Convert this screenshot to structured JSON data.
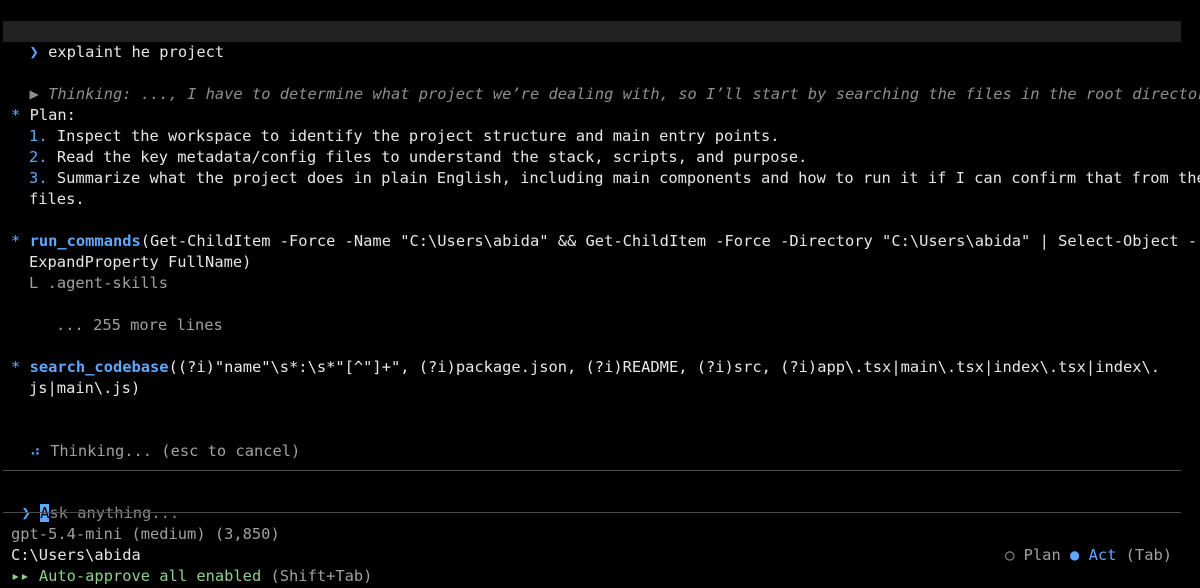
{
  "prompt": {
    "chevron": "❯",
    "text": "explaint he project"
  },
  "thinking": {
    "marker": "▶",
    "text": "Thinking: ..., I have to determine what project we’re dealing with, so I’ll start by searching the files in the root directory."
  },
  "plan": {
    "bullet": "*",
    "title": "Plan:",
    "steps": [
      {
        "num": "1.",
        "text": "Inspect the workspace to identify the project structure and main entry points."
      },
      {
        "num": "2.",
        "text": "Read the key metadata/config files to understand the stack, scripts, and purpose."
      },
      {
        "num": "3.",
        "text": "Summarize what the project does in plain English, including main components and how to run it if I can confirm that from the"
      },
      {
        "num": "",
        "text": "files."
      }
    ]
  },
  "run_commands": {
    "bullet": "*",
    "name": "run_commands",
    "open": "(",
    "line1": "Get-ChildItem -Force -Name \"C:\\Users\\abida\" && Get-ChildItem -Force -Directory \"C:\\Users\\abida\" | Select-Object -",
    "line2": "ExpandProperty FullName",
    "close": ")",
    "output_marker": "L",
    "output_first": ".agent-skills",
    "more_lines": "... 255 more lines"
  },
  "search_codebase": {
    "bullet": "*",
    "name": "search_codebase",
    "open": "(",
    "line1": "(?i)\"name\"\\s*:\\s*\"[^\"]+\", (?i)package.json, (?i)README, (?i)src, (?i)app\\.tsx|main\\.tsx|index\\.tsx|index\\.",
    "line2": "js|main\\.js",
    "close": ")"
  },
  "spinner": {
    "glyph": "⠴",
    "text": "Thinking... (esc to cancel)"
  },
  "input": {
    "chevron": "❯",
    "cursor_char": "A",
    "placeholder_rest": "sk anything..."
  },
  "status": {
    "model": "gpt-5.4-mini (medium) (3,850)",
    "cwd": "C:\\Users\\abida",
    "auto_marker": "▸▸",
    "auto_text": "Auto-approve all enabled",
    "auto_hint": "(Shift+Tab)",
    "mode_plan_dot": "○",
    "mode_plan": "Plan",
    "mode_act_dot": "●",
    "mode_act": "Act",
    "mode_hint": "(Tab)"
  },
  "colors": {
    "accent": "#5fa8ff",
    "background": "#000000",
    "green": "#8ed08e"
  }
}
